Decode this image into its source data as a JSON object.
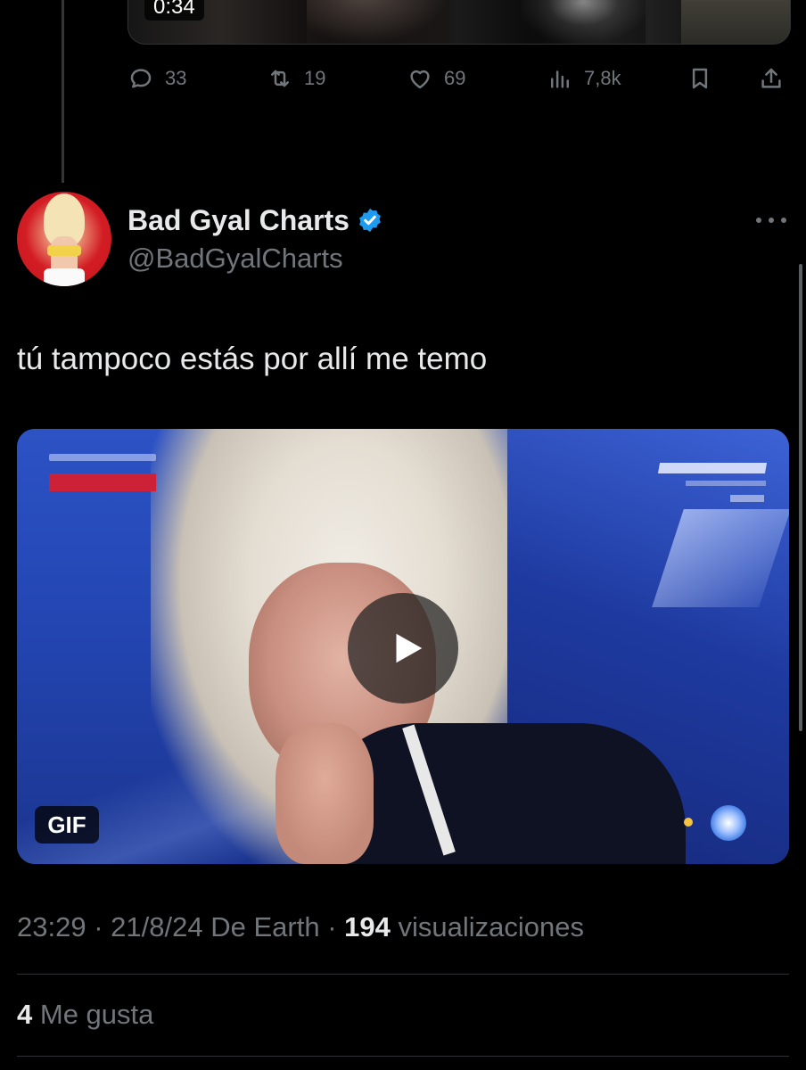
{
  "previous_tweet": {
    "video_duration": "0:34",
    "actions": {
      "replies": "33",
      "reposts": "19",
      "likes": "69",
      "views": "7,8k"
    }
  },
  "tweet": {
    "display_name": "Bad Gyal Charts",
    "handle": "@BadGyalCharts",
    "text": "tú tampoco estás por allí me temo",
    "media_badge": "GIF",
    "time": "23:29",
    "separator": "·",
    "date": "21/8/24",
    "source": "De Earth",
    "views_count": "194",
    "views_label": "visualizaciones",
    "likes_count": "4",
    "likes_label": "Me gusta"
  },
  "colors": {
    "background": "#000000",
    "text_primary": "#e7e9ea",
    "text_secondary": "#71767b",
    "verified_blue": "#1d9bf0",
    "divider": "#2f3336"
  },
  "icons": [
    "reply-icon",
    "repost-icon",
    "like-icon",
    "views-icon",
    "bookmark-icon",
    "share-icon",
    "verified-badge-icon",
    "more-options-icon",
    "play-icon"
  ]
}
